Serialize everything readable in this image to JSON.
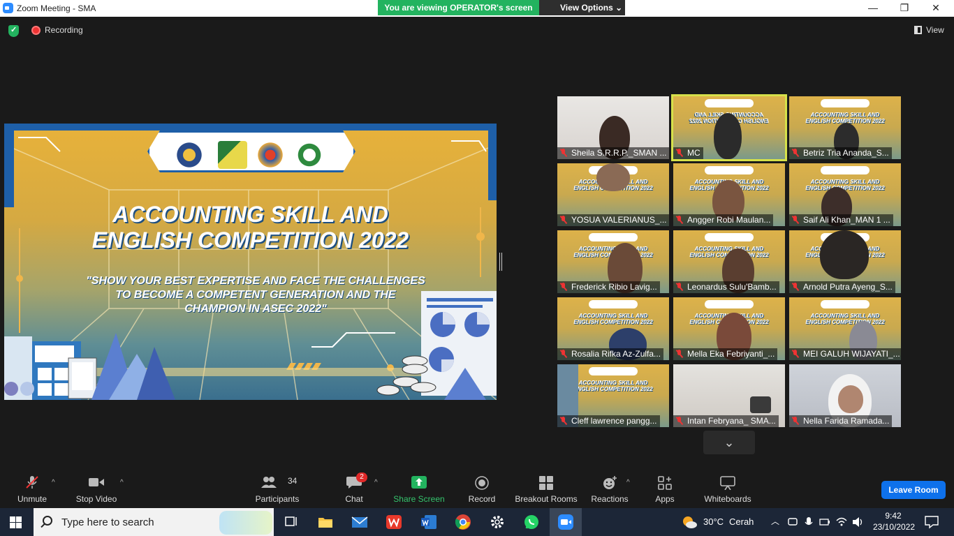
{
  "window": {
    "title": "Zoom Meeting - SMA",
    "viewing_banner": "You are viewing OPERATOR's screen",
    "view_options": "View Options",
    "minimize": "—",
    "maximize": "❐",
    "close": "✕"
  },
  "meeting_top": {
    "recording": "Recording",
    "view": "View"
  },
  "shared_slide": {
    "title_line1": "ACCOUNTING SKILL AND",
    "title_line2": "ENGLISH COMPETITION 2022",
    "quote": "\"SHOW YOUR BEST EXPERTISE AND FACE THE CHALLENGES TO BECOME A COMPETENT GENERATION AND THE CHAMPION IN ASEC 2022\""
  },
  "participants": [
    {
      "name": "Sheila S.R.R.P._SMAN ..."
    },
    {
      "name": "MC"
    },
    {
      "name": "Betriz Tria Ananda_S..."
    },
    {
      "name": "YOSUA VALERIANUS_..."
    },
    {
      "name": "Angger Robi Maulan..."
    },
    {
      "name": "Saif Ali Khan_MAN 1 ..."
    },
    {
      "name": "Frederick Ribio Lavig..."
    },
    {
      "name": "Leonardus Sulu'Bamb..."
    },
    {
      "name": "Arnold Putra Ayeng_S..."
    },
    {
      "name": "Rosalia Rifka Az-Zulfa..."
    },
    {
      "name": "Mella Eka Febriyanti_..."
    },
    {
      "name": "MEI GALUH WIJAYATI_..."
    },
    {
      "name": "Cleff lawrence pangg..."
    },
    {
      "name": "Intan Febryana_ SMA..."
    },
    {
      "name": "Nella Farida Ramada..."
    }
  ],
  "tile_slide_text": "ACCOUNTING SKILL AND ENGLISH COMPETITION 2022",
  "gallery_next": "⌄",
  "toolbar": {
    "unmute": "Unmute",
    "stop_video": "Stop Video",
    "participants": "Participants",
    "participants_count": "34",
    "chat": "Chat",
    "chat_badge": "2",
    "share_screen": "Share Screen",
    "record": "Record",
    "breakout_rooms": "Breakout Rooms",
    "reactions": "Reactions",
    "apps": "Apps",
    "whiteboards": "Whiteboards",
    "leave_room": "Leave Room",
    "caret": "^"
  },
  "taskbar": {
    "search_placeholder": "Type here to search",
    "weather_temp": "30°C",
    "weather_desc": "Cerah",
    "time": "9:42",
    "date": "23/10/2022"
  },
  "colors": {
    "share_green": "#23b35f",
    "leave_blue": "#0e71eb",
    "mute_red": "#e33333",
    "active_speaker": "#d6e14a"
  }
}
